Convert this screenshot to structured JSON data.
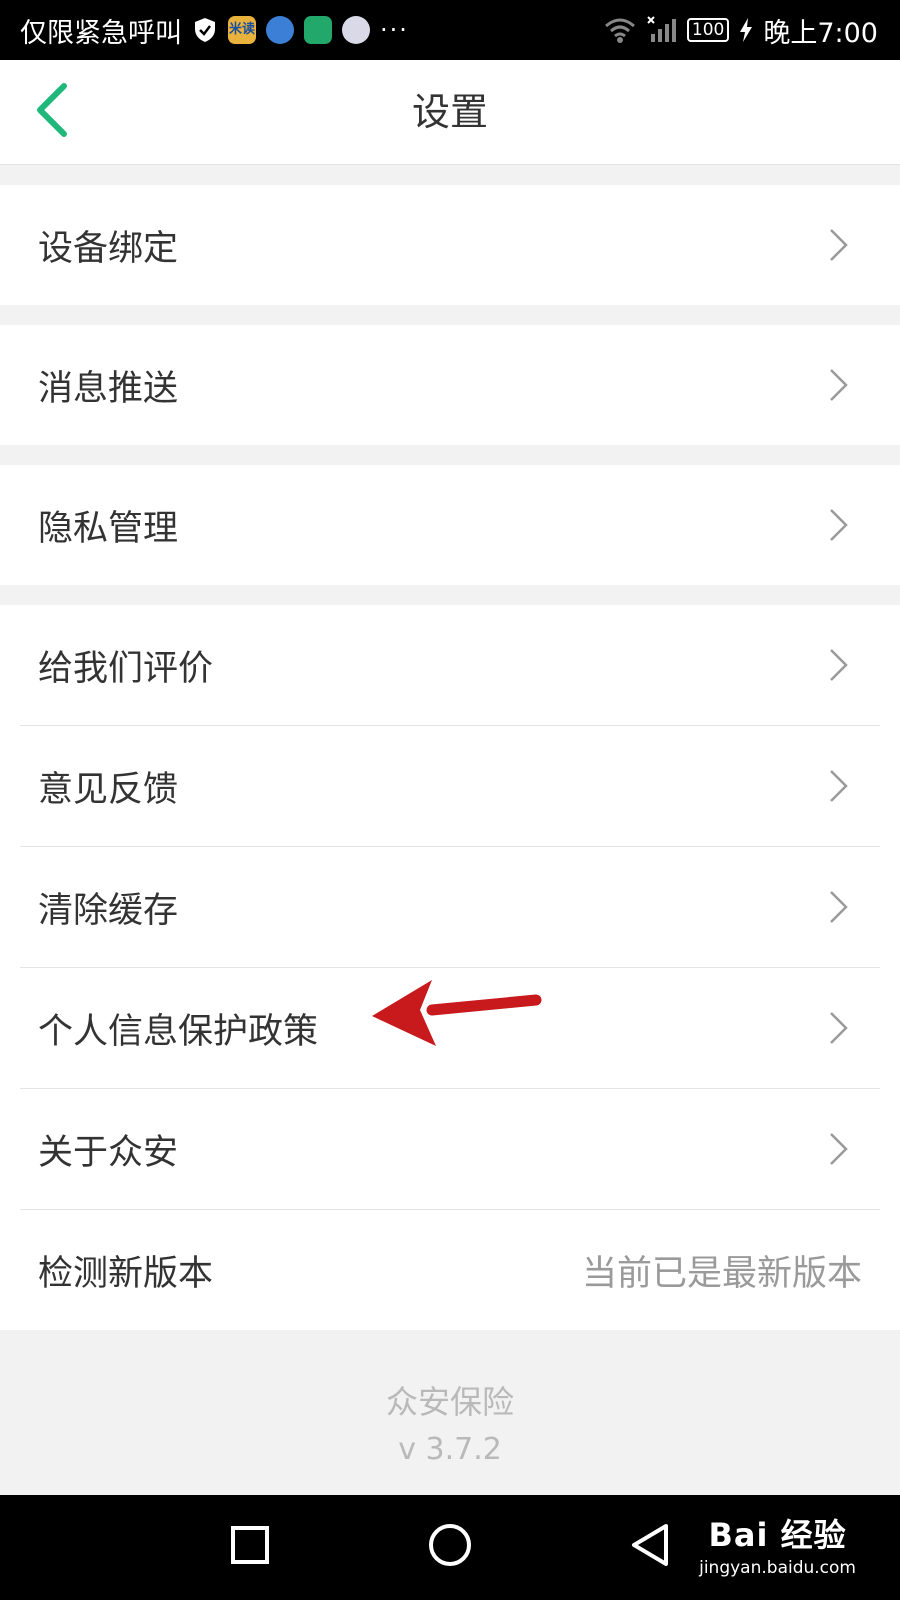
{
  "status_bar": {
    "carrier_text": "仅限紧急呼叫",
    "notif_icon_text": "米读",
    "more": "···",
    "battery": "100",
    "time": "晚上7:00"
  },
  "header": {
    "title": "设置"
  },
  "groups": [
    {
      "items": [
        {
          "label": "设备绑定"
        }
      ]
    },
    {
      "items": [
        {
          "label": "消息推送"
        }
      ]
    },
    {
      "items": [
        {
          "label": "隐私管理"
        }
      ]
    },
    {
      "items": [
        {
          "label": "给我们评价"
        },
        {
          "label": "意见反馈"
        },
        {
          "label": "清除缓存"
        },
        {
          "label": "个人信息保护政策"
        },
        {
          "label": "关于众安"
        },
        {
          "label": "检测新版本",
          "value": "当前已是最新版本"
        }
      ]
    }
  ],
  "footer": {
    "app_name": "众安保险",
    "version": "v 3.7.2"
  },
  "watermark": {
    "main": "Bai 经验",
    "sub": "jingyan.baidu.com"
  },
  "colors": {
    "accent": "#1fb87a",
    "annotation_arrow": "#c8191c"
  }
}
